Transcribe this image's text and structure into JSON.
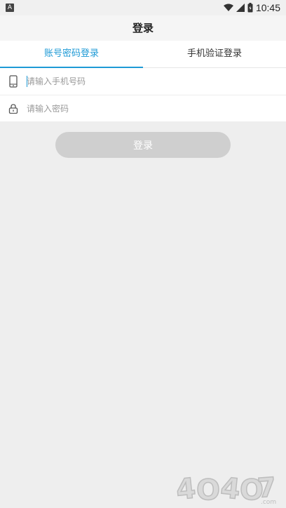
{
  "status_bar": {
    "left_badge": "A",
    "time": "10:45",
    "icons": [
      "wifi-icon",
      "signal-icon",
      "battery-icon"
    ]
  },
  "header": {
    "title": "登录"
  },
  "tabs": [
    {
      "label": "账号密码登录",
      "active": true
    },
    {
      "label": "手机验证登录",
      "active": false
    }
  ],
  "form": {
    "phone": {
      "value": "",
      "placeholder": "请输入手机号码",
      "icon": "phone-icon"
    },
    "password": {
      "value": "",
      "placeholder": "请输入密码",
      "icon": "lock-icon"
    }
  },
  "login_button": {
    "label": "登录"
  },
  "colors": {
    "accent": "#1e9ad6",
    "background": "#eeeeee",
    "button_disabled": "#cfcfcf"
  },
  "watermark": {
    "text": "4O4O7.com"
  }
}
